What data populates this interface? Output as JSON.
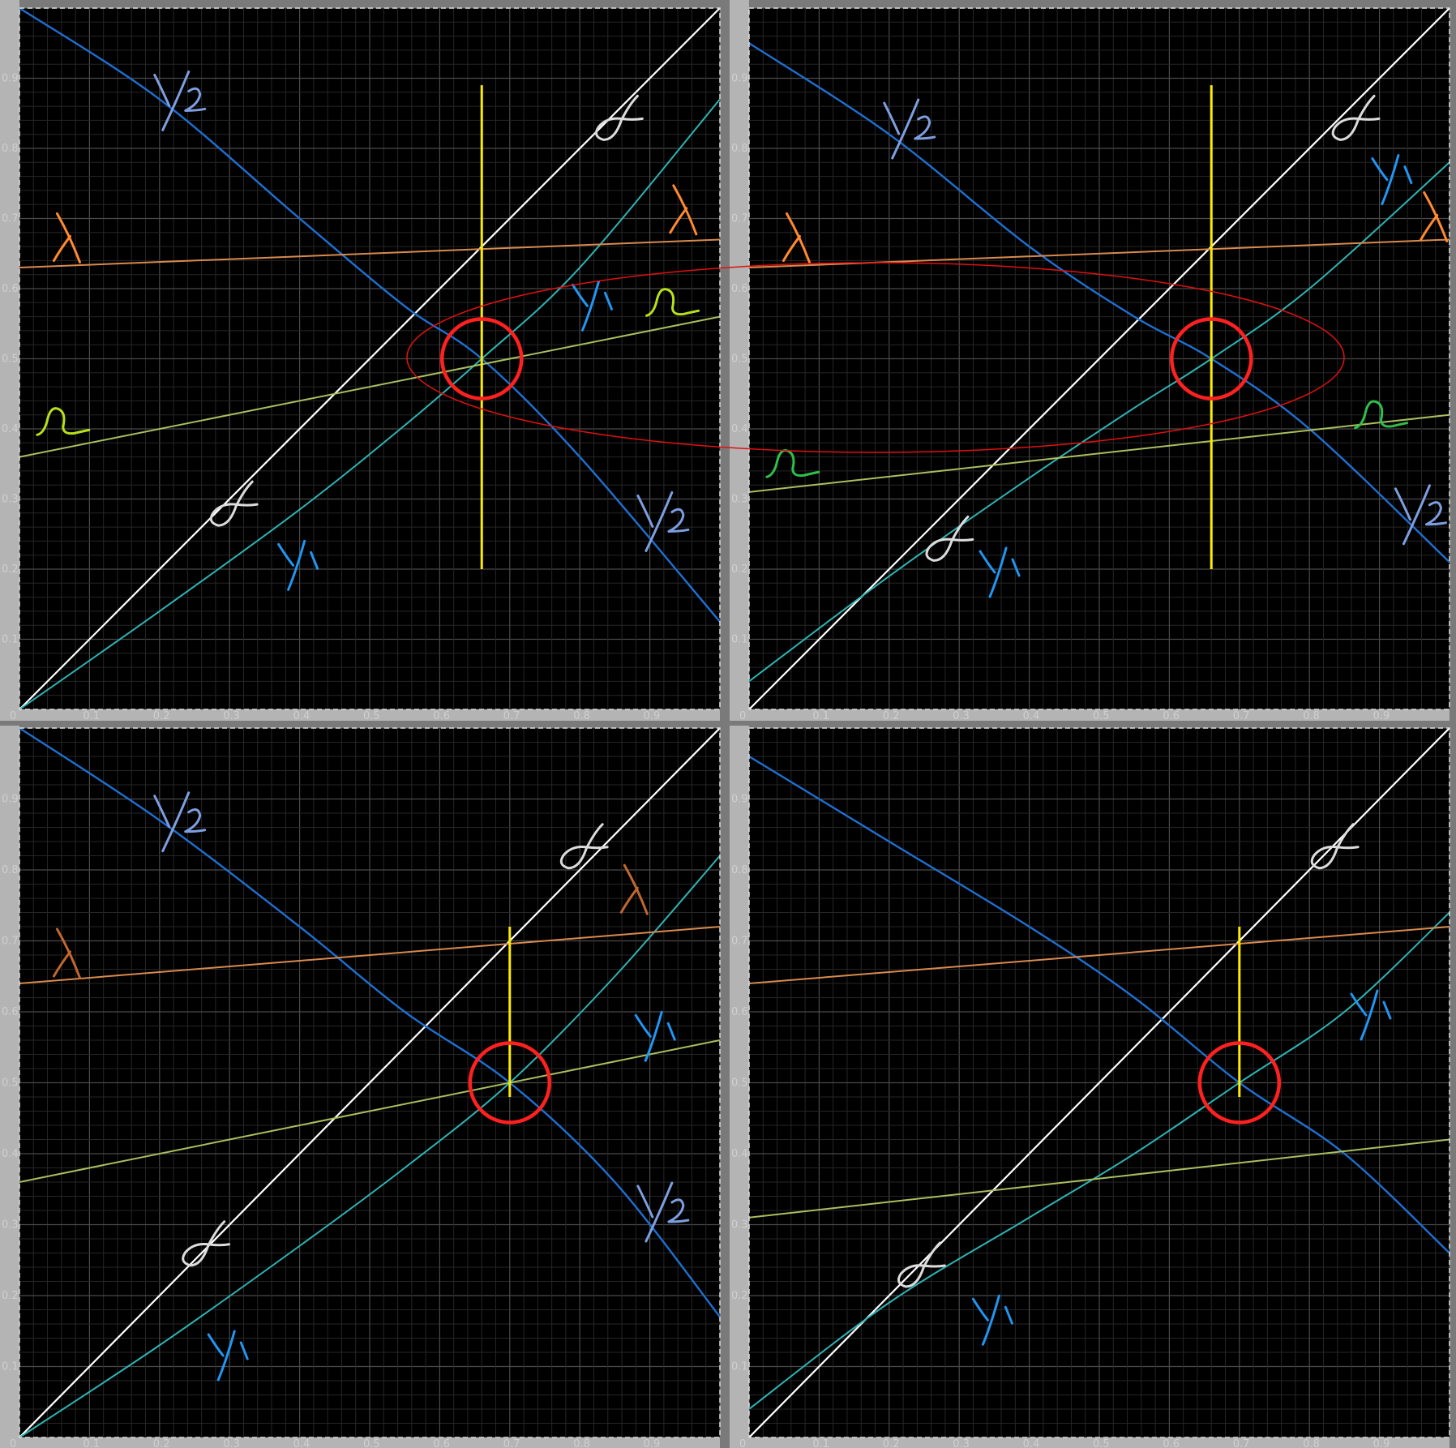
{
  "colors": {
    "background": "#000000",
    "frame": "#7a7a7a",
    "axis_strip": "#b4b4b4",
    "grid_minor": "#262626",
    "grid_major": "#4a4a4a",
    "diagonal": "#ffffff",
    "y2_line": "#1f6fd1",
    "y1_curve": "#2fb3b3",
    "lambda_line": "#d88a4e",
    "omega_line": "#a9bf5f",
    "marker_vertical": "#ffea00",
    "marker_circle": "#ff2020",
    "ellipse": "#e01010"
  },
  "annotations": {
    "y2": "Y2",
    "y1": "Y1",
    "lambda": "λ",
    "omega": "Ω",
    "alpha": "α"
  },
  "chart_data": [
    {
      "type": "line",
      "panel": "top-left",
      "xlim": [
        0,
        1
      ],
      "ylim": [
        0,
        1
      ],
      "x_ticks": [
        "0",
        "0.1",
        "0.2",
        "0.3",
        "0.4",
        "0.5",
        "0.6",
        "0.7",
        "0.8",
        "0.9"
      ],
      "y_ticks": [
        "0.1",
        "0.2",
        "0.3",
        "0.4",
        "0.5",
        "0.6",
        "0.7",
        "0.8",
        "0.9"
      ],
      "grid": true,
      "series": [
        {
          "key": "diagonal",
          "x": [
            0,
            1
          ],
          "y": [
            0,
            1
          ]
        },
        {
          "key": "y2",
          "x": [
            0,
            0.2,
            0.4,
            0.55,
            0.66,
            0.8,
            1.0
          ],
          "y": [
            1.0,
            0.87,
            0.7,
            0.575,
            0.5,
            0.36,
            0.125
          ]
        },
        {
          "key": "y1",
          "x": [
            0,
            0.2,
            0.4,
            0.55,
            0.66,
            0.8,
            1.0
          ],
          "y": [
            0.0,
            0.14,
            0.285,
            0.405,
            0.5,
            0.63,
            0.87
          ]
        },
        {
          "key": "lambda",
          "x": [
            0,
            1
          ],
          "y": [
            0.63,
            0.67
          ]
        },
        {
          "key": "omega",
          "x": [
            0,
            1
          ],
          "y": [
            0.36,
            0.56
          ]
        }
      ],
      "marker": {
        "x": 0.66,
        "y": 0.5,
        "vline_from": 0.2,
        "vline_to": 0.89
      },
      "annotations": [
        {
          "key": "y2",
          "x": 0.23,
          "y": 0.87
        },
        {
          "key": "y2",
          "x": 0.92,
          "y": 0.27
        },
        {
          "key": "alpha",
          "x": 0.85,
          "y": 0.84
        },
        {
          "key": "alpha",
          "x": 0.3,
          "y": 0.29
        },
        {
          "key": "lambda",
          "x": 0.07,
          "y": 0.67
        },
        {
          "key": "lambda",
          "x": 0.95,
          "y": 0.71
        },
        {
          "key": "y1",
          "x": 0.82,
          "y": 0.58
        },
        {
          "key": "y1",
          "x": 0.4,
          "y": 0.21
        },
        {
          "key": "omega",
          "x": 0.93,
          "y": 0.58
        },
        {
          "key": "omega",
          "x": 0.06,
          "y": 0.41
        }
      ]
    },
    {
      "type": "line",
      "panel": "top-right",
      "xlim": [
        0,
        1
      ],
      "ylim": [
        0,
        1
      ],
      "x_ticks": [
        "0",
        "0.1",
        "0.2",
        "0.3",
        "0.4",
        "0.5",
        "0.6",
        "0.7",
        "0.8",
        "0.9"
      ],
      "y_ticks": [
        "0.1",
        "0.2",
        "0.3",
        "0.4",
        "0.5",
        "0.6",
        "0.7",
        "0.8",
        "0.9"
      ],
      "grid": true,
      "series": [
        {
          "key": "diagonal",
          "x": [
            0,
            1
          ],
          "y": [
            0,
            1
          ]
        },
        {
          "key": "y2",
          "x": [
            0,
            0.2,
            0.4,
            0.55,
            0.66,
            0.8,
            1.0
          ],
          "y": [
            0.95,
            0.82,
            0.66,
            0.56,
            0.5,
            0.4,
            0.21
          ]
        },
        {
          "key": "y1",
          "x": [
            0,
            0.2,
            0.4,
            0.55,
            0.66,
            0.8,
            1.0
          ],
          "y": [
            0.04,
            0.19,
            0.33,
            0.43,
            0.5,
            0.6,
            0.78
          ]
        },
        {
          "key": "lambda",
          "x": [
            0,
            1
          ],
          "y": [
            0.63,
            0.67
          ]
        },
        {
          "key": "omega",
          "x": [
            0,
            1
          ],
          "y": [
            0.31,
            0.42
          ]
        }
      ],
      "marker": {
        "x": 0.66,
        "y": 0.5,
        "vline_from": 0.2,
        "vline_to": 0.89
      },
      "annotations": [
        {
          "key": "y2",
          "x": 0.23,
          "y": 0.83
        },
        {
          "key": "y2",
          "x": 0.96,
          "y": 0.28
        },
        {
          "key": "alpha",
          "x": 0.86,
          "y": 0.84
        },
        {
          "key": "alpha",
          "x": 0.28,
          "y": 0.24
        },
        {
          "key": "lambda",
          "x": 0.07,
          "y": 0.67
        },
        {
          "key": "lambda",
          "x": 0.98,
          "y": 0.7
        },
        {
          "key": "y1",
          "x": 0.92,
          "y": 0.76
        },
        {
          "key": "y1",
          "x": 0.36,
          "y": 0.2
        },
        {
          "key": "omega",
          "x": 0.9,
          "y": 0.42
        },
        {
          "key": "omega",
          "x": 0.06,
          "y": 0.35
        }
      ]
    },
    {
      "type": "line",
      "panel": "bottom-left",
      "xlim": [
        0,
        1
      ],
      "ylim": [
        0,
        1
      ],
      "x_ticks": [
        "0",
        "0.1",
        "0.2",
        "0.3",
        "0.4",
        "0.5",
        "0.6",
        "0.7",
        "0.8",
        "0.9"
      ],
      "y_ticks": [
        "0.1",
        "0.2",
        "0.3",
        "0.4",
        "0.5",
        "0.6",
        "0.7",
        "0.8",
        "0.9"
      ],
      "grid": true,
      "series": [
        {
          "key": "diagonal",
          "x": [
            0,
            1
          ],
          "y": [
            0,
            1
          ]
        },
        {
          "key": "y2",
          "x": [
            0,
            0.2,
            0.4,
            0.55,
            0.7,
            0.85,
            1.0
          ],
          "y": [
            1.0,
            0.87,
            0.72,
            0.6,
            0.5,
            0.36,
            0.17
          ]
        },
        {
          "key": "y1",
          "x": [
            0,
            0.2,
            0.4,
            0.55,
            0.7,
            0.85,
            1.0
          ],
          "y": [
            0.0,
            0.13,
            0.27,
            0.38,
            0.5,
            0.65,
            0.82
          ]
        },
        {
          "key": "lambda",
          "x": [
            0,
            1
          ],
          "y": [
            0.64,
            0.72
          ]
        },
        {
          "key": "omega",
          "x": [
            0,
            1
          ],
          "y": [
            0.36,
            0.56
          ]
        }
      ],
      "marker": {
        "x": 0.7,
        "y": 0.5,
        "vline_from": 0.48,
        "vline_to": 0.72
      },
      "annotations": [
        {
          "key": "y2",
          "x": 0.23,
          "y": 0.87
        },
        {
          "key": "y2",
          "x": 0.92,
          "y": 0.32
        },
        {
          "key": "alpha",
          "x": 0.8,
          "y": 0.83
        },
        {
          "key": "alpha",
          "x": 0.26,
          "y": 0.27
        },
        {
          "key": "lambda",
          "x": 0.07,
          "y": 0.68
        },
        {
          "key": "lambda",
          "x": 0.88,
          "y": 0.77
        },
        {
          "key": "y1",
          "x": 0.91,
          "y": 0.57
        },
        {
          "key": "y1",
          "x": 0.3,
          "y": 0.12
        }
      ]
    },
    {
      "type": "line",
      "panel": "bottom-right",
      "xlim": [
        0,
        1
      ],
      "ylim": [
        0,
        1
      ],
      "x_ticks": [
        "0",
        "0.1",
        "0.2",
        "0.3",
        "0.4",
        "0.5",
        "0.6",
        "0.7",
        "0.8",
        "0.9"
      ],
      "y_ticks": [
        "0.1",
        "0.2",
        "0.3",
        "0.4",
        "0.5",
        "0.6",
        "0.7",
        "0.8",
        "0.9"
      ],
      "grid": true,
      "series": [
        {
          "key": "diagonal",
          "x": [
            0,
            1
          ],
          "y": [
            0,
            1
          ]
        },
        {
          "key": "y2",
          "x": [
            0,
            0.2,
            0.4,
            0.55,
            0.7,
            0.85,
            1.0
          ],
          "y": [
            0.96,
            0.84,
            0.72,
            0.62,
            0.5,
            0.4,
            0.26
          ]
        },
        {
          "key": "y1",
          "x": [
            0,
            0.2,
            0.4,
            0.55,
            0.7,
            0.85,
            1.0
          ],
          "y": [
            0.04,
            0.19,
            0.31,
            0.4,
            0.5,
            0.6,
            0.74
          ]
        },
        {
          "key": "lambda",
          "x": [
            0,
            1
          ],
          "y": [
            0.64,
            0.72
          ]
        },
        {
          "key": "omega",
          "x": [
            0,
            1
          ],
          "y": [
            0.31,
            0.42
          ]
        }
      ],
      "marker": {
        "x": 0.7,
        "y": 0.5,
        "vline_from": 0.48,
        "vline_to": 0.72
      },
      "annotations": [
        {
          "key": "alpha",
          "x": 0.83,
          "y": 0.83
        },
        {
          "key": "alpha",
          "x": 0.24,
          "y": 0.24
        },
        {
          "key": "y1",
          "x": 0.89,
          "y": 0.6
        },
        {
          "key": "y1",
          "x": 0.35,
          "y": 0.17
        }
      ]
    }
  ]
}
